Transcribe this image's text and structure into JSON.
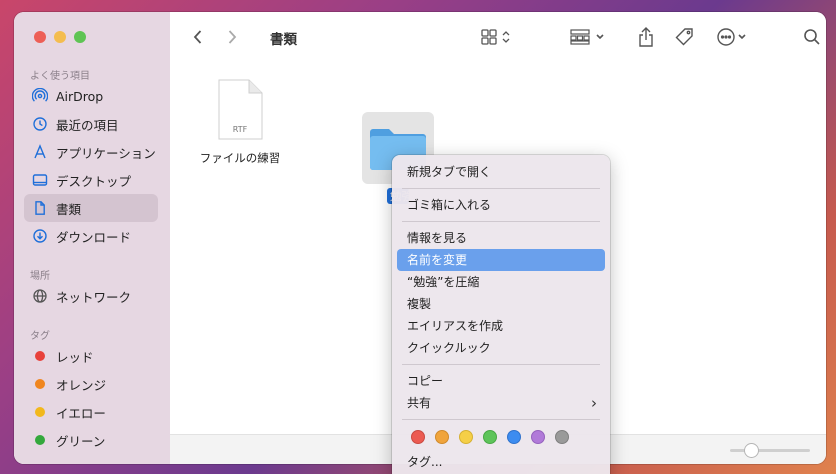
{
  "window": {
    "title": "書類"
  },
  "sidebar": {
    "favorites_label": "よく使う項目",
    "favorites": [
      {
        "label": "AirDrop",
        "icon": "airdrop-icon"
      },
      {
        "label": "最近の項目",
        "icon": "clock-icon"
      },
      {
        "label": "アプリケーション",
        "icon": "applications-icon"
      },
      {
        "label": "デスクトップ",
        "icon": "desktop-icon"
      },
      {
        "label": "書類",
        "icon": "document-icon",
        "selected": true
      },
      {
        "label": "ダウンロード",
        "icon": "download-icon"
      }
    ],
    "locations_label": "場所",
    "locations": [
      {
        "label": "ネットワーク",
        "icon": "network-icon"
      }
    ],
    "tags_label": "タグ",
    "tags": [
      {
        "label": "レッド",
        "color": "#e8413b"
      },
      {
        "label": "オレンジ",
        "color": "#f0861f"
      },
      {
        "label": "イエロー",
        "color": "#f2b81c"
      },
      {
        "label": "グリーン",
        "color": "#34a83c"
      }
    ]
  },
  "files": [
    {
      "name": "ファイルの練習",
      "type_badge": "RTF"
    },
    {
      "name": "勉強",
      "type": "folder"
    }
  ],
  "context_menu": {
    "items": [
      "新規タブで開く",
      "ゴミ箱に入れる",
      "情報を見る",
      "名前を変更",
      "“勉強”を圧縮",
      "複製",
      "エイリアスを作成",
      "クイックルック",
      "コピー",
      "共有",
      "タグ..."
    ],
    "highlighted": "名前を変更",
    "share_chevron": "›",
    "tag_colors": [
      "#ec5b52",
      "#f0a43c",
      "#f5cf47",
      "#5ec45a",
      "#3d8cf0",
      "#b17ad9",
      "#9a9a9a"
    ]
  },
  "accent": "#6aa0ec"
}
